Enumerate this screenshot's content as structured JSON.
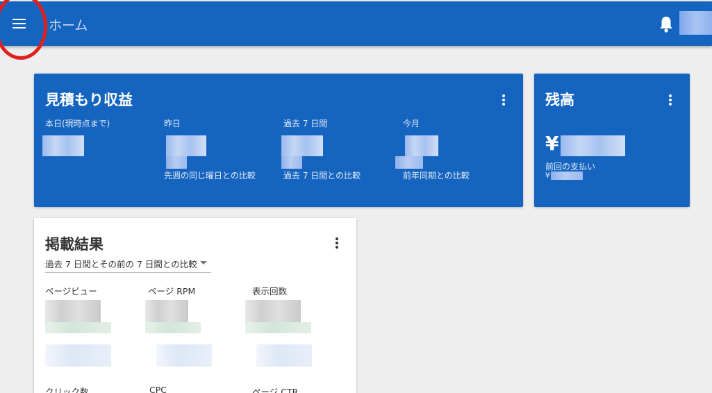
{
  "appbar": {
    "title": "ホーム"
  },
  "estimated_earnings": {
    "title": "見積もり収益",
    "columns": [
      {
        "label": "本日(現時点まで)",
        "comparison": ""
      },
      {
        "label": "昨日",
        "comparison": "先週の同じ曜日との比較"
      },
      {
        "label": "過去 7 日間",
        "comparison": "過去 7 日間との比較"
      },
      {
        "label": "今月",
        "comparison": "前年同期との比較"
      }
    ]
  },
  "balance": {
    "title": "残高",
    "currency_symbol": "¥",
    "last_payment_label": "前回の支払い",
    "last_payment_currency": "¥"
  },
  "performance": {
    "title": "掲載結果",
    "period_selector": "過去 7 日間とその前の 7 日間との比較",
    "metrics_row1": [
      "ページビュー",
      "ページ RPM",
      "表示回数"
    ],
    "metrics_row2": [
      "クリック数",
      "CPC",
      "ページ CTR"
    ]
  },
  "icons": {
    "menu": "menu-icon",
    "notifications": "bell-icon",
    "more": "more-vert-icon"
  },
  "colors": {
    "appbar": "#1565c0",
    "highlight": "#e0201c",
    "background": "#eeeeee"
  }
}
